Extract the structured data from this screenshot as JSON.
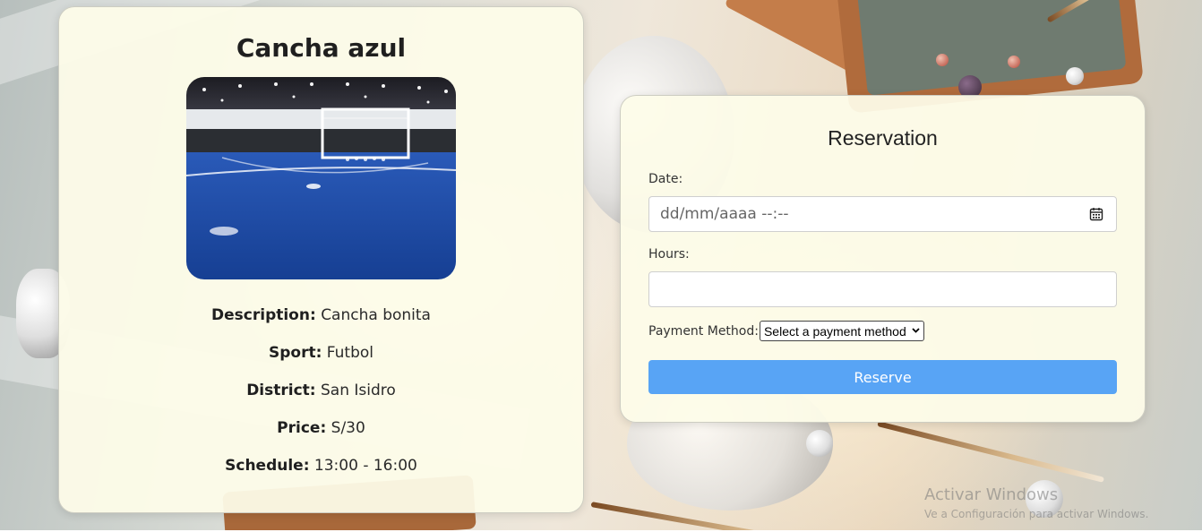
{
  "court": {
    "title": "Cancha azul",
    "image_alt": "Blue indoor futsal court",
    "details": [
      {
        "key": "Description:",
        "value": "Cancha bonita"
      },
      {
        "key": "Sport:",
        "value": "Futbol"
      },
      {
        "key": "District:",
        "value": "San Isidro"
      },
      {
        "key": "Price:",
        "value": "S/30"
      },
      {
        "key": "Schedule:",
        "value": "13:00 - 16:00"
      }
    ]
  },
  "reservation": {
    "title": "Reservation",
    "date_label": "Date:",
    "date_placeholder": "dd/mm/aaaa --:--",
    "hours_label": "Hours:",
    "hours_value": "",
    "payment_label": "Payment Method:",
    "payment_selected": "Select a payment method",
    "reserve_label": "Reserve"
  },
  "watermark": {
    "title": "Activar Windows",
    "subtitle": "Ve a Configuración para activar Windows."
  },
  "colors": {
    "accent": "#58a4f5",
    "card_bg": "#fdfce9",
    "court_blue": "#1f4fa8"
  },
  "icons": {
    "calendar": "calendar-icon",
    "dropdown": "chevron-down-icon"
  }
}
